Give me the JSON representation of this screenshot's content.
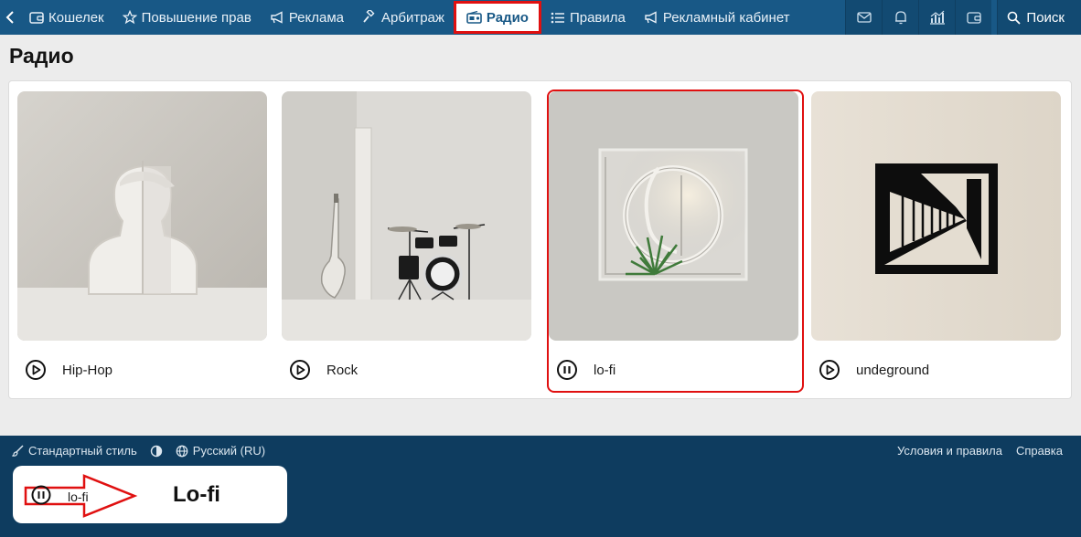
{
  "nav": {
    "items": [
      {
        "label": "Кошелек",
        "icon": "wallet-icon"
      },
      {
        "label": "Повышение прав",
        "icon": "star-icon"
      },
      {
        "label": "Реклама",
        "icon": "megaphone-icon"
      },
      {
        "label": "Арбитраж",
        "icon": "gavel-icon"
      },
      {
        "label": "Радио",
        "icon": "radio-icon",
        "active": true
      },
      {
        "label": "Правила",
        "icon": "list-icon"
      },
      {
        "label": "Рекламный кабинет",
        "icon": "megaphone-icon"
      }
    ],
    "icons": [
      "mail-icon",
      "bell-icon",
      "chart-icon",
      "wallet-icon"
    ],
    "search_label": "Поиск"
  },
  "page": {
    "title": "Радио"
  },
  "stations": [
    {
      "name": "Hip-Hop",
      "state": "play"
    },
    {
      "name": "Rock",
      "state": "play"
    },
    {
      "name": "lo-fi",
      "state": "pause",
      "selected": true
    },
    {
      "name": "undeground",
      "state": "play"
    }
  ],
  "footer": {
    "style_label": "Стандартный стиль",
    "language_label": "Русский (RU)",
    "terms_label": "Условия и правила",
    "help_label": "Справка"
  },
  "player": {
    "track": "lo-fi",
    "annotation": "Lo-fi"
  },
  "colors": {
    "nav_bg": "#185886",
    "footer_bg": "#0e3c5f",
    "highlight": "#e01010"
  }
}
